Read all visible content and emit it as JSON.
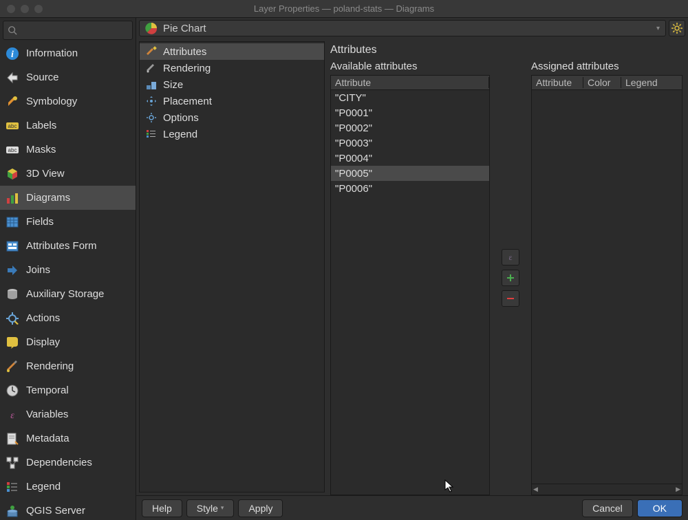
{
  "title": "Layer Properties — poland-stats — Diagrams",
  "sidebar": {
    "search_placeholder": "",
    "items": [
      {
        "id": "information",
        "label": "Information"
      },
      {
        "id": "source",
        "label": "Source"
      },
      {
        "id": "symbology",
        "label": "Symbology"
      },
      {
        "id": "labels",
        "label": "Labels"
      },
      {
        "id": "masks",
        "label": "Masks"
      },
      {
        "id": "3dview",
        "label": "3D View"
      },
      {
        "id": "diagrams",
        "label": "Diagrams"
      },
      {
        "id": "fields",
        "label": "Fields"
      },
      {
        "id": "attrform",
        "label": "Attributes Form"
      },
      {
        "id": "joins",
        "label": "Joins"
      },
      {
        "id": "aux",
        "label": "Auxiliary Storage"
      },
      {
        "id": "actions",
        "label": "Actions"
      },
      {
        "id": "display",
        "label": "Display"
      },
      {
        "id": "rendering",
        "label": "Rendering"
      },
      {
        "id": "temporal",
        "label": "Temporal"
      },
      {
        "id": "variables",
        "label": "Variables"
      },
      {
        "id": "metadata",
        "label": "Metadata"
      },
      {
        "id": "dependencies",
        "label": "Dependencies"
      },
      {
        "id": "legend",
        "label": "Legend"
      },
      {
        "id": "qgisserver",
        "label": "QGIS Server"
      }
    ],
    "selected": "diagrams"
  },
  "diagram_type": "Pie Chart",
  "subnav": {
    "items": [
      {
        "id": "attributes",
        "label": "Attributes"
      },
      {
        "id": "rendering",
        "label": "Rendering"
      },
      {
        "id": "size",
        "label": "Size"
      },
      {
        "id": "placement",
        "label": "Placement"
      },
      {
        "id": "options",
        "label": "Options"
      },
      {
        "id": "legend",
        "label": "Legend"
      }
    ],
    "selected": "attributes"
  },
  "pane": {
    "title": "Attributes",
    "available_title": "Available attributes",
    "available_header": "Attribute",
    "available": [
      "\"CITY\"",
      "\"P0001\"",
      "\"P0002\"",
      "\"P0003\"",
      "\"P0004\"",
      "\"P0005\"",
      "\"P0006\""
    ],
    "available_selected": 5,
    "assigned_title": "Assigned attributes",
    "assigned_headers": [
      "Attribute",
      "Color",
      "Legend"
    ],
    "assigned": []
  },
  "buttons": {
    "help": "Help",
    "style": "Style",
    "apply": "Apply",
    "cancel": "Cancel",
    "ok": "OK"
  }
}
